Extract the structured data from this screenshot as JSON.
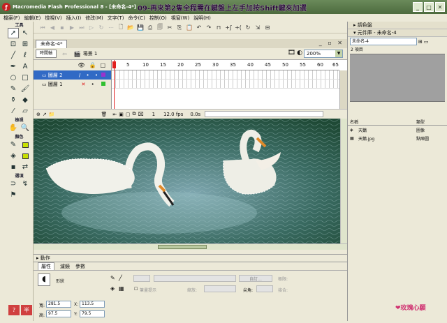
{
  "window": {
    "app": "Macromedia Flash Professional 8 - [未命名-4*]",
    "hint": "09-再來第2隻全程需在鍵盤上左手加按Shift鍵來加選"
  },
  "menu": [
    "檔案(F)",
    "編輯(E)",
    "檢視(V)",
    "插入(I)",
    "修改(M)",
    "文字(T)",
    "命令(C)",
    "控制(O)",
    "視窗(W)",
    "說明(H)"
  ],
  "tools": {
    "header": "工具",
    "view": "檢視",
    "colors": "顏色",
    "options": "選項"
  },
  "document": {
    "tab": "未命名-4*",
    "timeline_btn": "時間軸",
    "scene": "場景 1",
    "zoom": "200%"
  },
  "timeline": {
    "ruler": [
      "1",
      "5",
      "10",
      "15",
      "20",
      "25",
      "30",
      "35",
      "40",
      "45",
      "50",
      "55",
      "60",
      "65"
    ],
    "layers": [
      {
        "name": "圖層 2",
        "active": true
      },
      {
        "name": "圖層 1",
        "active": false
      }
    ],
    "frame": "1",
    "fps": "12.0 fps",
    "time": "0.0s"
  },
  "panels": {
    "actions": "動作",
    "props_tabs": [
      "屬性",
      "濾鏡",
      "參數"
    ],
    "shape": "形狀",
    "stroke_hint": "筆畫提示",
    "scale": "縮放:",
    "cap": "尖角:",
    "custom": "自訂...",
    "limit": "極限:",
    "join": "接合:"
  },
  "props": {
    "w_label": "寬:",
    "w": "281.5",
    "x_label": "X:",
    "x": "113.5",
    "h_label": "高:",
    "h": "97.5",
    "y_label": "Y:",
    "y": "79.5"
  },
  "right": {
    "color_panel": "調色盤",
    "library_panel": "元件庫 - 未命名-4",
    "library_select": "未命名-4",
    "count": "2 項目",
    "col_name": "名稱",
    "col_type": "類型",
    "items": [
      {
        "name": "天鵝",
        "type": "圖像"
      },
      {
        "name": "天鵝.jpg",
        "type": "點陣圖"
      }
    ]
  },
  "logo": "玫瑰心願",
  "colors": {
    "title": "#5b7a4b",
    "stage": "#2c5a3a",
    "accent": "#316ac5"
  }
}
